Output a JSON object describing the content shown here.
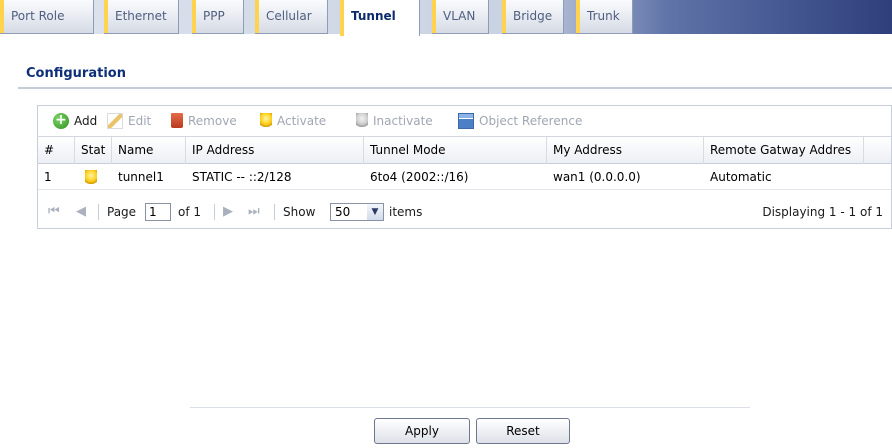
{
  "tabs": [
    {
      "label": "Port Role",
      "active": false
    },
    {
      "label": "Ethernet",
      "active": false
    },
    {
      "label": "PPP",
      "active": false
    },
    {
      "label": "Cellular",
      "active": false
    },
    {
      "label": "Tunnel",
      "active": true
    },
    {
      "label": "VLAN",
      "active": false
    },
    {
      "label": "Bridge",
      "active": false
    },
    {
      "label": "Trunk",
      "active": false
    }
  ],
  "section": {
    "title": "Configuration"
  },
  "toolbar": {
    "add": "Add",
    "edit": "Edit",
    "remove": "Remove",
    "activate": "Activate",
    "inactivate": "Inactivate",
    "object_reference": "Object Reference"
  },
  "table": {
    "columns": [
      "#",
      "Stat",
      "Name",
      "IP Address",
      "Tunnel Mode",
      "My Address",
      "Remote Gatway Addres"
    ],
    "rows": [
      {
        "index": "1",
        "status": "bulb-on-icon",
        "name": "tunnel1",
        "ip_address": "STATIC -- ::2/128",
        "tunnel_mode": "6to4 (2002::/16)",
        "my_address": "wan1 (0.0.0.0)",
        "remote_gateway": "Automatic"
      }
    ]
  },
  "pager": {
    "page_label": "Page",
    "page_value": "1",
    "of_label": "of 1",
    "show_label": "Show",
    "per_page": "50",
    "items_label": "items",
    "displaying": "Displaying 1 - 1 of 1"
  },
  "buttons": {
    "apply": "Apply",
    "reset": "Reset"
  },
  "colors": {
    "title": "#0e2f78",
    "tab_accent": "#ffd34d",
    "bulb_on": "#ffd21f"
  }
}
